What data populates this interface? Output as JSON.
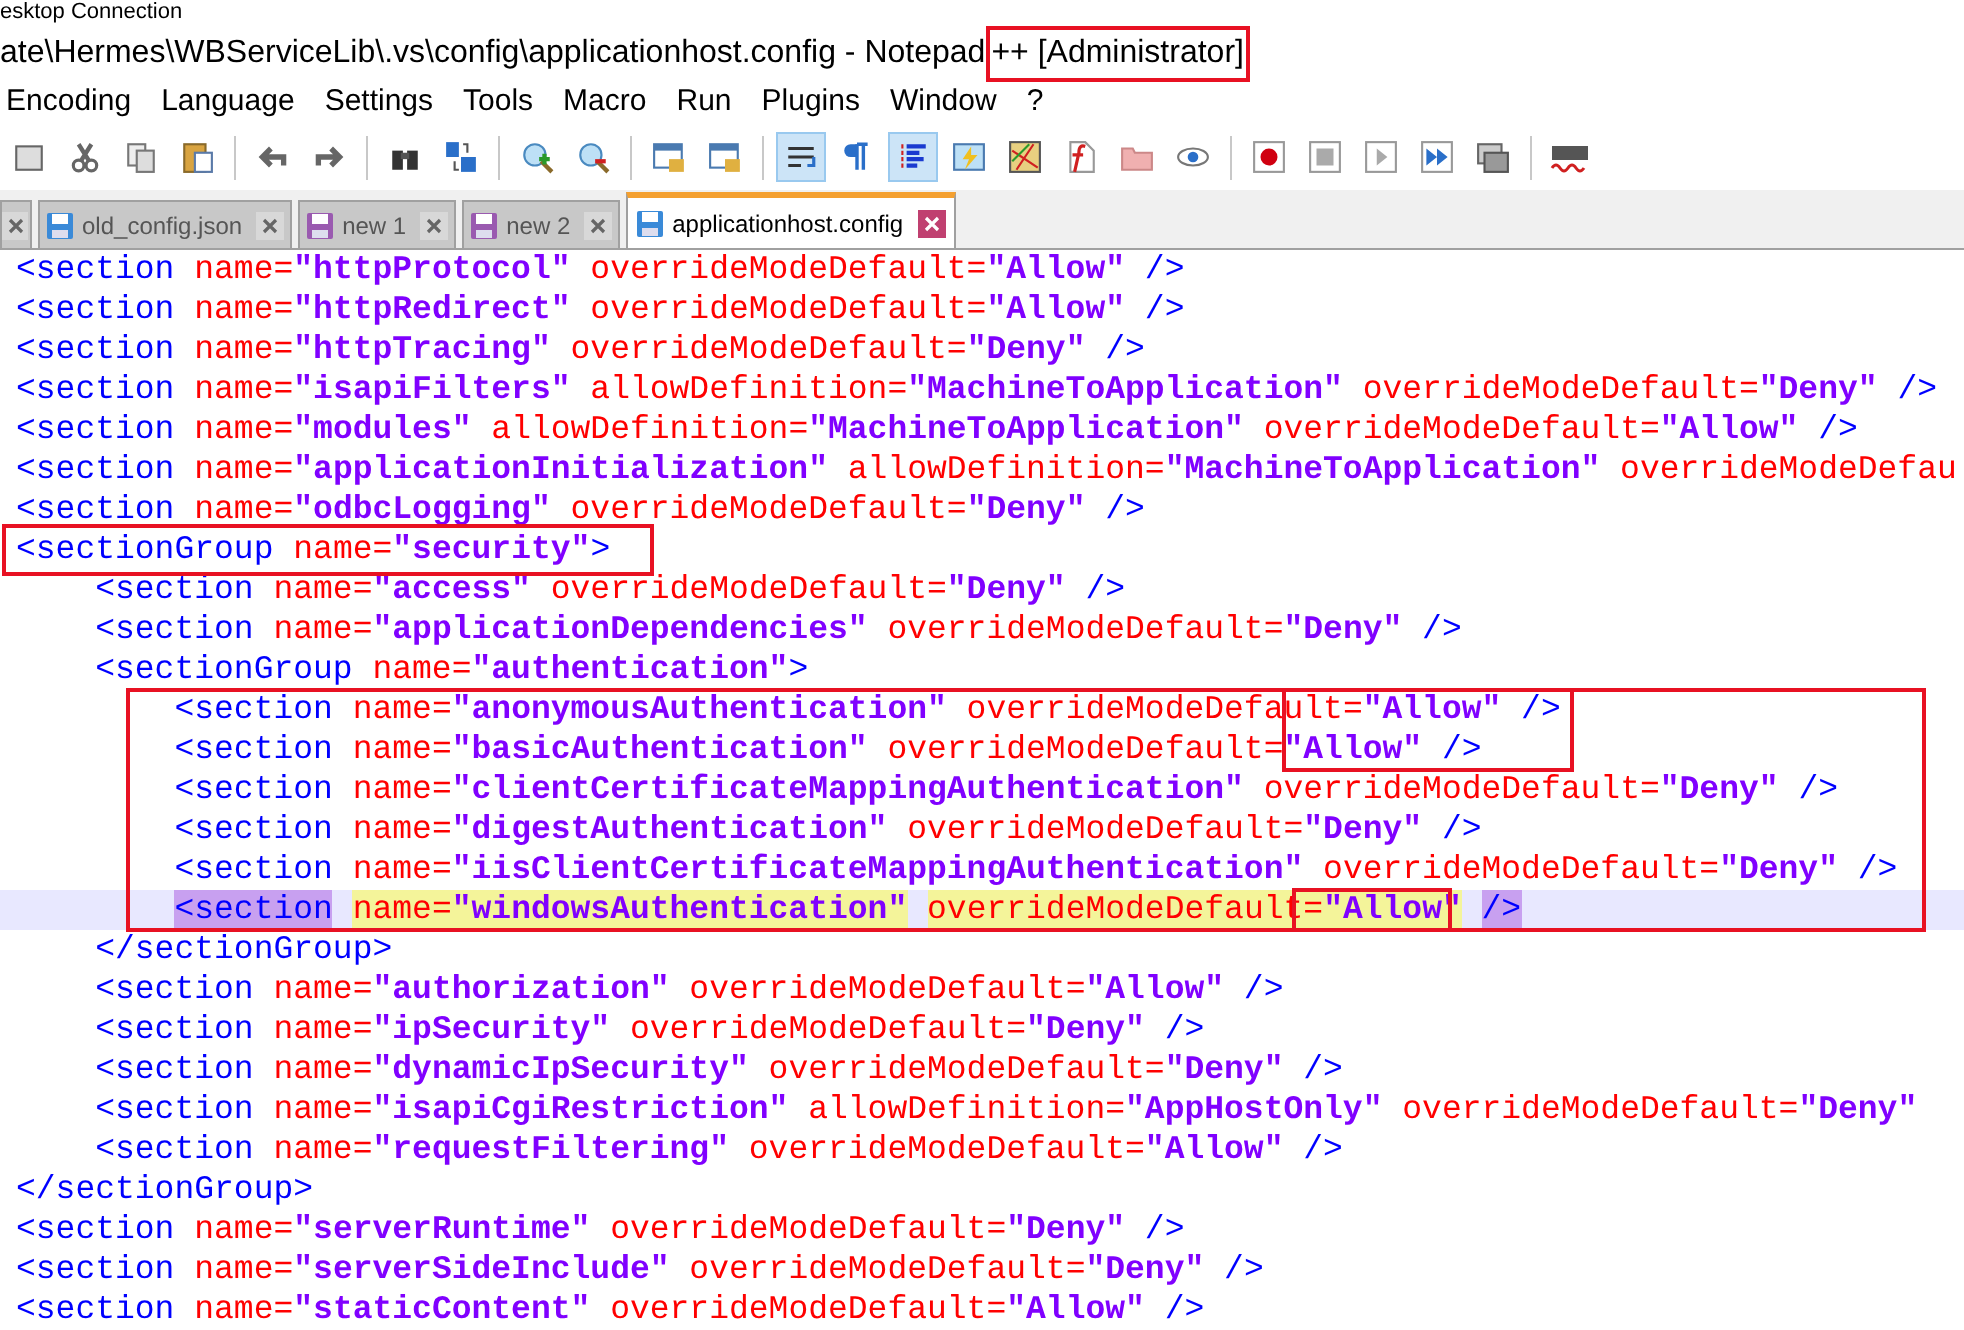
{
  "remote_bar": {
    "title": "esktop Connection"
  },
  "window": {
    "title": "ate\\Hermes\\WBServiceLib\\.vs\\config\\applicationhost.config - Notepad",
    "title_highlighted": "++ [Administrator]"
  },
  "menu": [
    "Encoding",
    "Language",
    "Settings",
    "Tools",
    "Macro",
    "Run",
    "Plugins",
    "Window",
    "?"
  ],
  "toolbar": [
    {
      "pressed": false
    },
    {
      "pressed": false
    },
    {
      "pressed": false
    },
    {
      "pressed": false
    },
    {
      "pressed": false
    },
    {
      "pressed": false
    },
    {
      "pressed": false
    },
    {
      "pressed": false
    },
    {
      "pressed": false
    },
    {
      "pressed": false
    },
    {
      "pressed": false
    },
    {
      "pressed": false
    },
    {
      "pressed": true
    },
    {
      "pressed": false
    },
    {
      "pressed": true
    },
    {
      "pressed": false
    },
    {
      "pressed": false
    },
    {
      "pressed": false
    },
    {
      "pressed": false
    },
    {
      "pressed": false
    },
    {
      "pressed": false
    },
    {
      "pressed": false
    },
    {
      "pressed": false
    },
    {
      "pressed": false
    },
    {
      "pressed": false
    }
  ],
  "tabs": [
    {
      "kind": "cut",
      "selected": false
    },
    {
      "kind": "file",
      "label": "old_config.json",
      "saved": true,
      "selected": false
    },
    {
      "kind": "file",
      "label": "new 1",
      "saved": false,
      "selected": false
    },
    {
      "kind": "file",
      "label": "new 2",
      "saved": false,
      "selected": false
    },
    {
      "kind": "file",
      "label": "applicationhost.config",
      "saved": true,
      "selected": true
    }
  ],
  "editor": {
    "lines": [
      {
        "current": false,
        "tokens": [
          {
            "kind": "tag",
            "text": "<section"
          },
          {
            "kind": "attr",
            "text": " name="
          },
          {
            "kind": "value",
            "text": "\"httpProtocol\""
          },
          {
            "kind": "attr",
            "text": " overrideModeDefault="
          },
          {
            "kind": "value",
            "text": "\"Allow\""
          },
          {
            "kind": "tag",
            "text": " />"
          }
        ]
      },
      {
        "current": false,
        "tokens": [
          {
            "kind": "tag",
            "text": "<section"
          },
          {
            "kind": "attr",
            "text": " name="
          },
          {
            "kind": "value",
            "text": "\"httpRedirect\""
          },
          {
            "kind": "attr",
            "text": " overrideModeDefault="
          },
          {
            "kind": "value",
            "text": "\"Allow\""
          },
          {
            "kind": "tag",
            "text": " />"
          }
        ]
      },
      {
        "current": false,
        "tokens": [
          {
            "kind": "tag",
            "text": "<section"
          },
          {
            "kind": "attr",
            "text": " name="
          },
          {
            "kind": "value",
            "text": "\"httpTracing\""
          },
          {
            "kind": "attr",
            "text": " overrideModeDefault="
          },
          {
            "kind": "value",
            "text": "\"Deny\""
          },
          {
            "kind": "tag",
            "text": " />"
          }
        ]
      },
      {
        "current": false,
        "tokens": [
          {
            "kind": "tag",
            "text": "<section"
          },
          {
            "kind": "attr",
            "text": " name="
          },
          {
            "kind": "value",
            "text": "\"isapiFilters\""
          },
          {
            "kind": "attr",
            "text": " allowDefinition="
          },
          {
            "kind": "value",
            "text": "\"MachineToApplication\""
          },
          {
            "kind": "attr",
            "text": " overrideModeDefault="
          },
          {
            "kind": "value",
            "text": "\"Deny\""
          },
          {
            "kind": "tag",
            "text": " />"
          }
        ]
      },
      {
        "current": false,
        "tokens": [
          {
            "kind": "tag",
            "text": "<section"
          },
          {
            "kind": "attr",
            "text": " name="
          },
          {
            "kind": "value",
            "text": "\"modules\""
          },
          {
            "kind": "attr",
            "text": " allowDefinition="
          },
          {
            "kind": "value",
            "text": "\"MachineToApplication\""
          },
          {
            "kind": "attr",
            "text": " overrideModeDefault="
          },
          {
            "kind": "value",
            "text": "\"Allow\""
          },
          {
            "kind": "tag",
            "text": " />"
          }
        ]
      },
      {
        "current": false,
        "tokens": [
          {
            "kind": "tag",
            "text": "<section"
          },
          {
            "kind": "attr",
            "text": " name="
          },
          {
            "kind": "value",
            "text": "\"applicationInitialization\""
          },
          {
            "kind": "attr",
            "text": " allowDefinition="
          },
          {
            "kind": "value",
            "text": "\"MachineToApplication\""
          },
          {
            "kind": "attr",
            "text": " overrideModeDefau"
          }
        ]
      },
      {
        "current": false,
        "tokens": [
          {
            "kind": "tag",
            "text": "<section"
          },
          {
            "kind": "attr",
            "text": " name="
          },
          {
            "kind": "value",
            "text": "\"odbcLogging\""
          },
          {
            "kind": "attr",
            "text": " overrideModeDefault="
          },
          {
            "kind": "value",
            "text": "\"Deny\""
          },
          {
            "kind": "tag",
            "text": " />"
          }
        ]
      },
      {
        "current": false,
        "boxed": true,
        "tokens": [
          {
            "kind": "tag",
            "text": "<sectionGroup"
          },
          {
            "kind": "attr",
            "text": " name="
          },
          {
            "kind": "value",
            "text": "\"security\""
          },
          {
            "kind": "tag",
            "text": ">"
          }
        ]
      },
      {
        "current": false,
        "tokens": [
          {
            "kind": "tag",
            "text": "    <section"
          },
          {
            "kind": "attr",
            "text": " name="
          },
          {
            "kind": "value",
            "text": "\"access\""
          },
          {
            "kind": "attr",
            "text": " overrideModeDefault="
          },
          {
            "kind": "value",
            "text": "\"Deny\""
          },
          {
            "kind": "tag",
            "text": " />"
          }
        ]
      },
      {
        "current": false,
        "tokens": [
          {
            "kind": "tag",
            "text": "    <section"
          },
          {
            "kind": "attr",
            "text": " name="
          },
          {
            "kind": "value",
            "text": "\"applicationDependencies\""
          },
          {
            "kind": "attr",
            "text": " overrideModeDefault="
          },
          {
            "kind": "value",
            "text": "\"Deny\""
          },
          {
            "kind": "tag",
            "text": " />"
          }
        ]
      },
      {
        "current": false,
        "tokens": [
          {
            "kind": "tag",
            "text": "    <sectionGroup"
          },
          {
            "kind": "attr",
            "text": " name="
          },
          {
            "kind": "value",
            "text": "\"authentication\""
          },
          {
            "kind": "tag",
            "text": ">"
          }
        ]
      },
      {
        "current": false,
        "tokens": [
          {
            "kind": "tag",
            "text": "        <section"
          },
          {
            "kind": "attr",
            "text": " name="
          },
          {
            "kind": "value",
            "text": "\"anonymousAuthentication\""
          },
          {
            "kind": "attr",
            "text": " overrideModeDefault="
          },
          {
            "kind": "value",
            "text": "\"Allow\""
          },
          {
            "kind": "tag",
            "text": " />"
          }
        ]
      },
      {
        "current": false,
        "tokens": [
          {
            "kind": "tag",
            "text": "        <section"
          },
          {
            "kind": "attr",
            "text": " name="
          },
          {
            "kind": "value",
            "text": "\"basicAuthentication\""
          },
          {
            "kind": "attr",
            "text": " overrideModeDefault="
          },
          {
            "kind": "value",
            "text": "\"Allow\""
          },
          {
            "kind": "tag",
            "text": " />"
          }
        ]
      },
      {
        "current": false,
        "tokens": [
          {
            "kind": "tag",
            "text": "        <section"
          },
          {
            "kind": "attr",
            "text": " name="
          },
          {
            "kind": "value",
            "text": "\"clientCertificateMappingAuthentication\""
          },
          {
            "kind": "attr",
            "text": " overrideModeDefault="
          },
          {
            "kind": "value",
            "text": "\"Deny\""
          },
          {
            "kind": "tag",
            "text": " />"
          }
        ]
      },
      {
        "current": false,
        "tokens": [
          {
            "kind": "tag",
            "text": "        <section"
          },
          {
            "kind": "attr",
            "text": " name="
          },
          {
            "kind": "value",
            "text": "\"digestAuthentication\""
          },
          {
            "kind": "attr",
            "text": " overrideModeDefault="
          },
          {
            "kind": "value",
            "text": "\"Deny\""
          },
          {
            "kind": "tag",
            "text": " />"
          }
        ]
      },
      {
        "current": false,
        "tokens": [
          {
            "kind": "tag",
            "text": "        <section"
          },
          {
            "kind": "attr",
            "text": " name="
          },
          {
            "kind": "value",
            "text": "\"iisClientCertificateMappingAuthentication\""
          },
          {
            "kind": "attr",
            "text": " overrideModeDefault="
          },
          {
            "kind": "value",
            "text": "\"Deny\""
          },
          {
            "kind": "tag",
            "text": " />"
          }
        ]
      },
      {
        "current": true,
        "tokens": [
          {
            "kind": "tag",
            "text": "        <section",
            "highlighted": true
          },
          {
            "kind": "attr",
            "text": " name=",
            "highlighted": true
          },
          {
            "kind": "value",
            "text": "\"windowsAuthentication\"",
            "highlighted": true
          },
          {
            "kind": "attr",
            "text": " overrideModeDefault=",
            "highlighted": true
          },
          {
            "kind": "value",
            "text": "\"Allow\"",
            "highlighted": true
          },
          {
            "kind": "tag",
            "text": " />",
            "highlighted": true
          }
        ]
      },
      {
        "current": false,
        "tokens": [
          {
            "kind": "tag",
            "text": "    </sectionGroup>"
          }
        ]
      },
      {
        "current": false,
        "tokens": [
          {
            "kind": "tag",
            "text": "    <section"
          },
          {
            "kind": "attr",
            "text": " name="
          },
          {
            "kind": "value",
            "text": "\"authorization\""
          },
          {
            "kind": "attr",
            "text": " overrideModeDefault="
          },
          {
            "kind": "value",
            "text": "\"Allow\""
          },
          {
            "kind": "tag",
            "text": " />"
          }
        ]
      },
      {
        "current": false,
        "tokens": [
          {
            "kind": "tag",
            "text": "    <section"
          },
          {
            "kind": "attr",
            "text": " name="
          },
          {
            "kind": "value",
            "text": "\"ipSecurity\""
          },
          {
            "kind": "attr",
            "text": " overrideModeDefault="
          },
          {
            "kind": "value",
            "text": "\"Deny\""
          },
          {
            "kind": "tag",
            "text": " />"
          }
        ]
      },
      {
        "current": false,
        "tokens": [
          {
            "kind": "tag",
            "text": "    <section"
          },
          {
            "kind": "attr",
            "text": " name="
          },
          {
            "kind": "value",
            "text": "\"dynamicIpSecurity\""
          },
          {
            "kind": "attr",
            "text": " overrideModeDefault="
          },
          {
            "kind": "value",
            "text": "\"Deny\""
          },
          {
            "kind": "tag",
            "text": " />"
          }
        ]
      },
      {
        "current": false,
        "tokens": [
          {
            "kind": "tag",
            "text": "    <section"
          },
          {
            "kind": "attr",
            "text": " name="
          },
          {
            "kind": "value",
            "text": "\"isapiCgiRestriction\""
          },
          {
            "kind": "attr",
            "text": " allowDefinition="
          },
          {
            "kind": "value",
            "text": "\"AppHostOnly\""
          },
          {
            "kind": "attr",
            "text": " overrideModeDefault="
          },
          {
            "kind": "value",
            "text": "\"Deny\""
          }
        ]
      },
      {
        "current": false,
        "tokens": [
          {
            "kind": "tag",
            "text": "    <section"
          },
          {
            "kind": "attr",
            "text": " name="
          },
          {
            "kind": "value",
            "text": "\"requestFiltering\""
          },
          {
            "kind": "attr",
            "text": " overrideModeDefault="
          },
          {
            "kind": "value",
            "text": "\"Allow\""
          },
          {
            "kind": "tag",
            "text": " />"
          }
        ]
      },
      {
        "current": false,
        "tokens": [
          {
            "kind": "tag",
            "text": "</sectionGroup>"
          }
        ]
      },
      {
        "current": false,
        "tokens": [
          {
            "kind": "tag",
            "text": "<section"
          },
          {
            "kind": "attr",
            "text": " name="
          },
          {
            "kind": "value",
            "text": "\"serverRuntime\""
          },
          {
            "kind": "attr",
            "text": " overrideModeDefault="
          },
          {
            "kind": "value",
            "text": "\"Deny\""
          },
          {
            "kind": "tag",
            "text": " />"
          }
        ]
      },
      {
        "current": false,
        "tokens": [
          {
            "kind": "tag",
            "text": "<section"
          },
          {
            "kind": "attr",
            "text": " name="
          },
          {
            "kind": "value",
            "text": "\"serverSideInclude\""
          },
          {
            "kind": "attr",
            "text": " overrideModeDefault="
          },
          {
            "kind": "value",
            "text": "\"Deny\""
          },
          {
            "kind": "tag",
            "text": " />"
          }
        ]
      },
      {
        "current": false,
        "tokens": [
          {
            "kind": "tag",
            "text": "<section"
          },
          {
            "kind": "attr",
            "text": " name="
          },
          {
            "kind": "value",
            "text": "\"staticContent\""
          },
          {
            "kind": "attr",
            "text": " overrideModeDefault="
          },
          {
            "kind": "value",
            "text": "\"Allow\""
          },
          {
            "kind": "tag",
            "text": " />"
          }
        ]
      }
    ]
  }
}
